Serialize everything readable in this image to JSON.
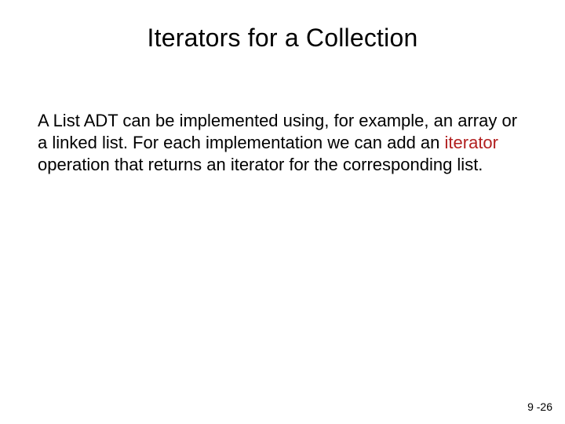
{
  "title": "Iterators for a Collection",
  "body": {
    "part1": "A List ADT can be implemented using, for example, an array or a linked list. For each implementation we can add an ",
    "highlight": "iterator",
    "part2": " operation that returns an iterator for the corresponding list."
  },
  "page_number": "9 -26"
}
